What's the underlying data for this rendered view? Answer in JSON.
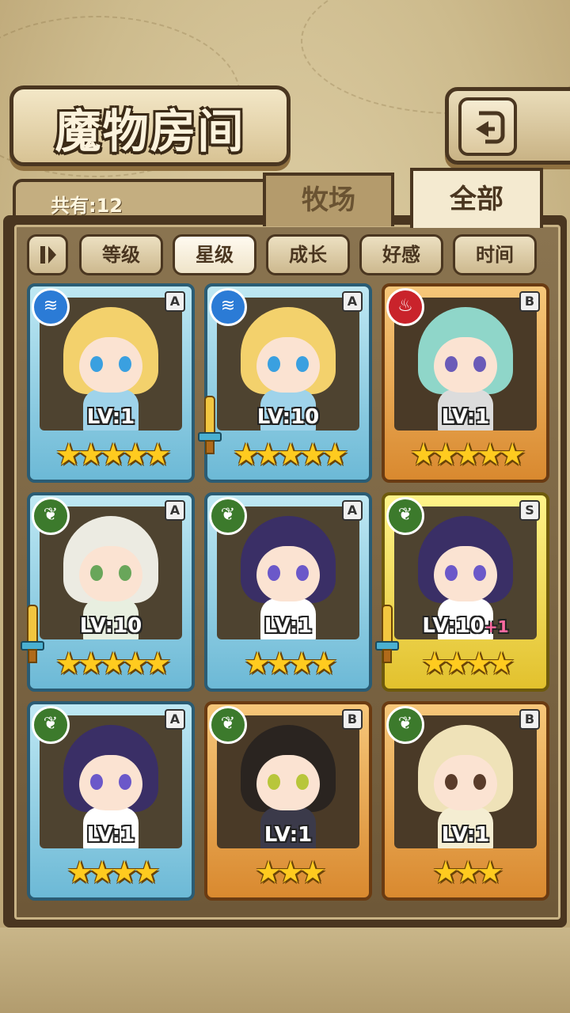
{
  "header": {
    "title": "魔物房间",
    "back_icon": "back-arrow-icon"
  },
  "info": {
    "count_label": "共有:12"
  },
  "tabs": [
    {
      "label": "牧场",
      "active": false
    },
    {
      "label": "全部",
      "active": true
    }
  ],
  "sort": {
    "toggle_icon": "sort-order-icon",
    "buttons": [
      {
        "label": "等级",
        "active": false
      },
      {
        "label": "星级",
        "active": true
      },
      {
        "label": "成长",
        "active": false
      },
      {
        "label": "好感",
        "active": false
      },
      {
        "label": "时间",
        "active": false
      }
    ]
  },
  "cards": [
    {
      "element": "water",
      "element_icon": "water-element-icon",
      "rank": "A",
      "frame": "blue",
      "level": "LV:1",
      "plus": "",
      "stars": 5,
      "equipped": false,
      "hair": "#f3d16c",
      "eyes": "#3aa0e0",
      "outfit": "#9fd3ea"
    },
    {
      "element": "water",
      "element_icon": "water-element-icon",
      "rank": "A",
      "frame": "blue",
      "level": "LV:10",
      "plus": "",
      "stars": 5,
      "equipped": true,
      "hair": "#f3d16c",
      "eyes": "#3aa0e0",
      "outfit": "#9fd3ea"
    },
    {
      "element": "fire",
      "element_icon": "fire-element-icon",
      "rank": "B",
      "frame": "orange",
      "level": "LV:1",
      "plus": "",
      "stars": 5,
      "equipped": false,
      "hair": "#8fd6c9",
      "eyes": "#6a5bb8",
      "outfit": "#dcdcdc"
    },
    {
      "element": "grass",
      "element_icon": "leaf-element-icon",
      "rank": "A",
      "frame": "blue",
      "level": "LV:10",
      "plus": "",
      "stars": 5,
      "equipped": true,
      "hair": "#ecebe2",
      "eyes": "#69a65a",
      "outfit": "#e8efe0"
    },
    {
      "element": "grass",
      "element_icon": "leaf-element-icon",
      "rank": "A",
      "frame": "blue",
      "level": "LV:1",
      "plus": "",
      "stars": 4,
      "equipped": false,
      "hair": "#3a2f66",
      "eyes": "#6b58c9",
      "outfit": "#ffffff"
    },
    {
      "element": "grass",
      "element_icon": "leaf-element-icon",
      "rank": "S",
      "frame": "gold",
      "level": "LV:10",
      "plus": "+1",
      "stars": 4,
      "equipped": true,
      "hair": "#3a2f66",
      "eyes": "#6b58c9",
      "outfit": "#ffffff"
    },
    {
      "element": "grass",
      "element_icon": "leaf-element-icon",
      "rank": "A",
      "frame": "blue",
      "level": "LV:1",
      "plus": "",
      "stars": 4,
      "equipped": false,
      "hair": "#3a2f66",
      "eyes": "#6b58c9",
      "outfit": "#ffffff"
    },
    {
      "element": "grass",
      "element_icon": "leaf-element-icon",
      "rank": "B",
      "frame": "orange",
      "level": "LV:1",
      "plus": "",
      "stars": 3,
      "equipped": false,
      "hair": "#2a2420",
      "eyes": "#b8c63a",
      "outfit": "#3b3a4a"
    },
    {
      "element": "grass",
      "element_icon": "leaf-element-icon",
      "rank": "B",
      "frame": "orange",
      "level": "LV:1",
      "plus": "",
      "stars": 3,
      "equipped": false,
      "hair": "#efe2b8",
      "eyes": "#5a3c2a",
      "outfit": "#f4edd2"
    }
  ]
}
